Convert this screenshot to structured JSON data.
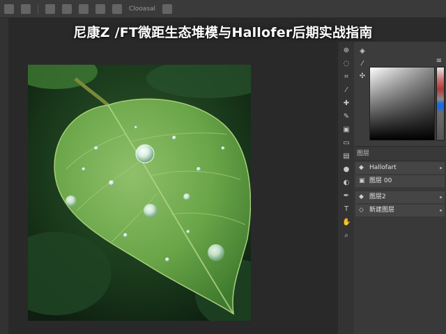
{
  "title": "尼康Z /FT微距生态堆模与Hallofer后期实战指南",
  "menubar": {
    "icons": [
      "home-icon",
      "grid-icon",
      "tool-icon",
      "folder-icon",
      "brush-icon",
      "layers-icon",
      "window-icon",
      "menu-icon"
    ],
    "dim_label": "Clooasal"
  },
  "tools": [
    "move-icon",
    "lasso-icon",
    "crop-icon",
    "eyedropper-icon",
    "healing-icon",
    "brush-icon",
    "stamp-icon",
    "eraser-icon",
    "gradient-icon",
    "blur-icon",
    "dodge-icon",
    "pen-icon",
    "type-icon",
    "hand-icon",
    "zoom-icon"
  ],
  "color_panel": {
    "icons": [
      "palette-icon",
      "eyedropper-icon",
      "adjust-icon"
    ],
    "colors": {
      "accent": "#1c6be0",
      "red": "#b13a3a"
    }
  },
  "layers_panel": {
    "header": "图层",
    "items": [
      {
        "label": "Hallofart",
        "icon": "eye-icon"
      },
      {
        "label": "图层 00",
        "icon": "layer-icon"
      },
      {
        "label": "图层2",
        "icon": "eye-icon"
      },
      {
        "label": "新建图层",
        "icon": "diamond-icon"
      }
    ]
  }
}
